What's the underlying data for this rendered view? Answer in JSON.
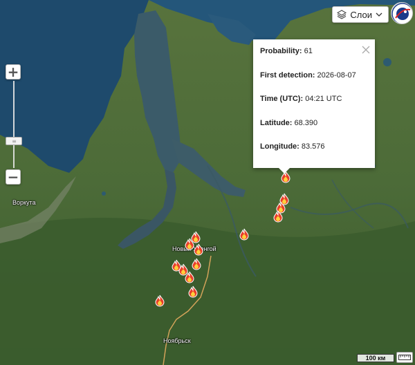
{
  "map": {
    "layers_button_label": "Слои",
    "scale_label": "100 км",
    "cities": [
      "Воркута",
      "Новый Уренгой",
      "Ноябрьск"
    ]
  },
  "popup": {
    "probability_label": "Probability:",
    "probability_value": "61",
    "first_detection_label": "First detection:",
    "first_detection_value": "2026-08-07",
    "time_label": "Time (UTC):",
    "time_value": "04:21 UTC",
    "latitude_label": "Latitude:",
    "latitude_value": "68.390",
    "longitude_label": "Longitude:",
    "longitude_value": "83.576"
  },
  "colors": {
    "sea": "#1f4f72",
    "river": "#3c5a67",
    "land_tundra": "#5d7a44",
    "land_forest": "#3d5e2f",
    "road": "#d3a35a",
    "fire_outer": "#e8402a",
    "fire_inner": "#ffcf3c"
  },
  "icons": {
    "fire": "fire-hotspot-icon",
    "layers": "layers-icon",
    "close": "close-icon",
    "ruler": "ruler-icon"
  }
}
